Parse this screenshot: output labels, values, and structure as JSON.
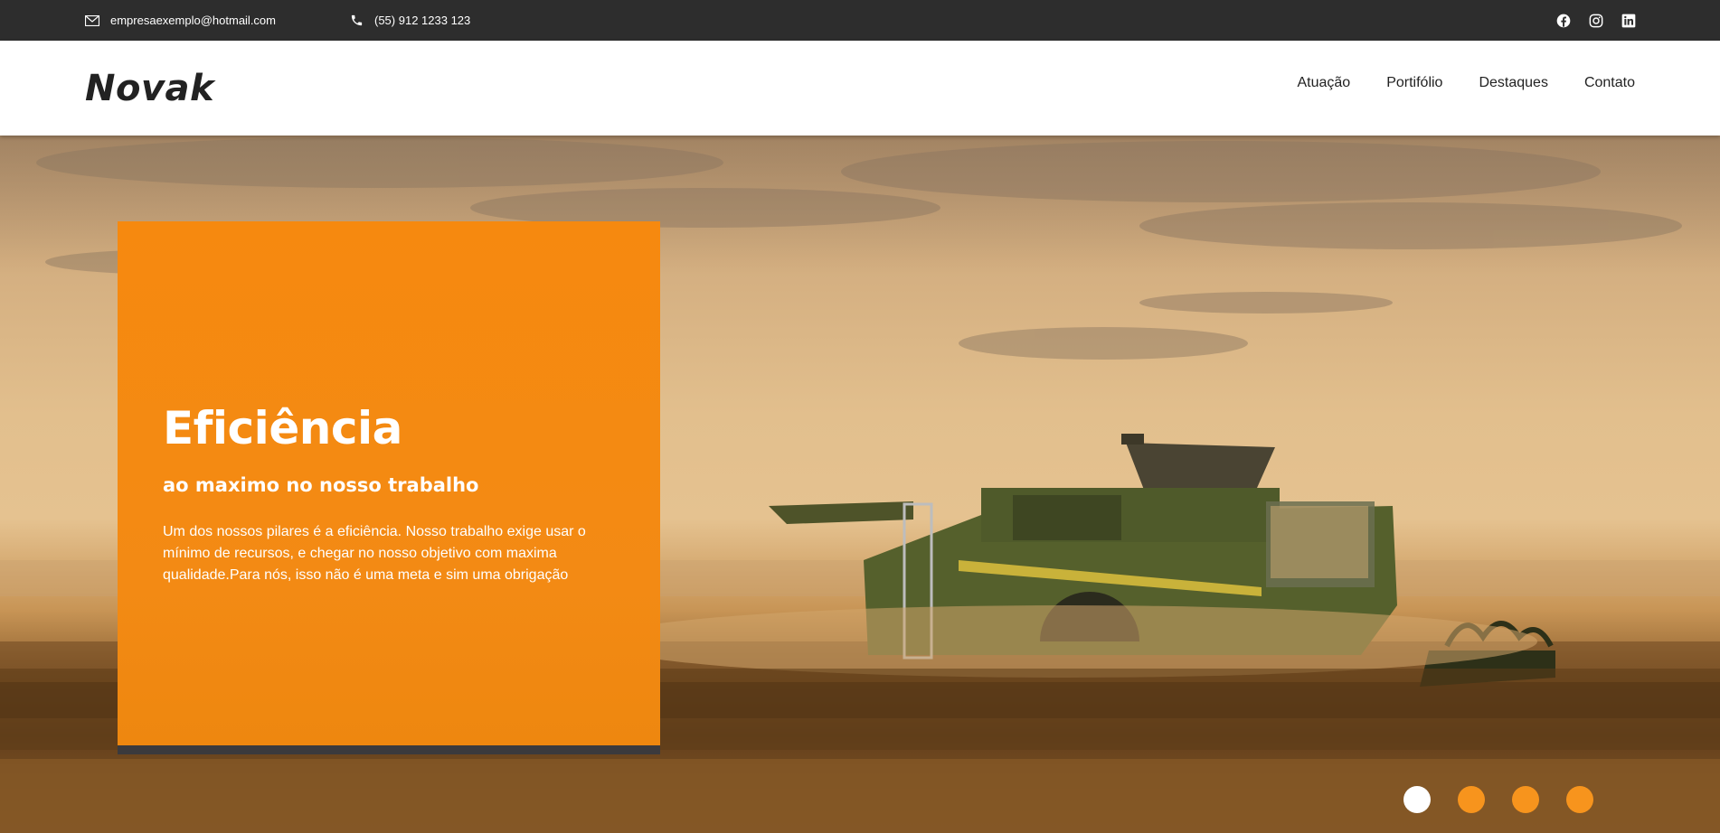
{
  "topbar": {
    "email": "empresaexemplo@hotmail.com",
    "phone": "(55) 912 1233 123",
    "socials": [
      "facebook-icon",
      "instagram-icon",
      "linkedin-icon"
    ]
  },
  "header": {
    "logo": "Novak",
    "nav": [
      "Atuação",
      "Portifólio",
      "Destaques",
      "Contato"
    ]
  },
  "hero": {
    "title": "Eficiência",
    "subtitle": "ao maximo no nosso trabalho",
    "text": "Um dos nossos pilares é a eficiência. Nosso trabalho exige usar o mínimo de recursos, e chegar no nosso objetivo com maxima qualidade.Para nós, isso não é uma meta e sim uma obrigação",
    "slides": 4,
    "active_slide": 1
  },
  "colors": {
    "topbar": "#2d2d2d",
    "accent": "#f6890f",
    "card_border": "#3b3a3d",
    "dot": "#f7941d"
  }
}
